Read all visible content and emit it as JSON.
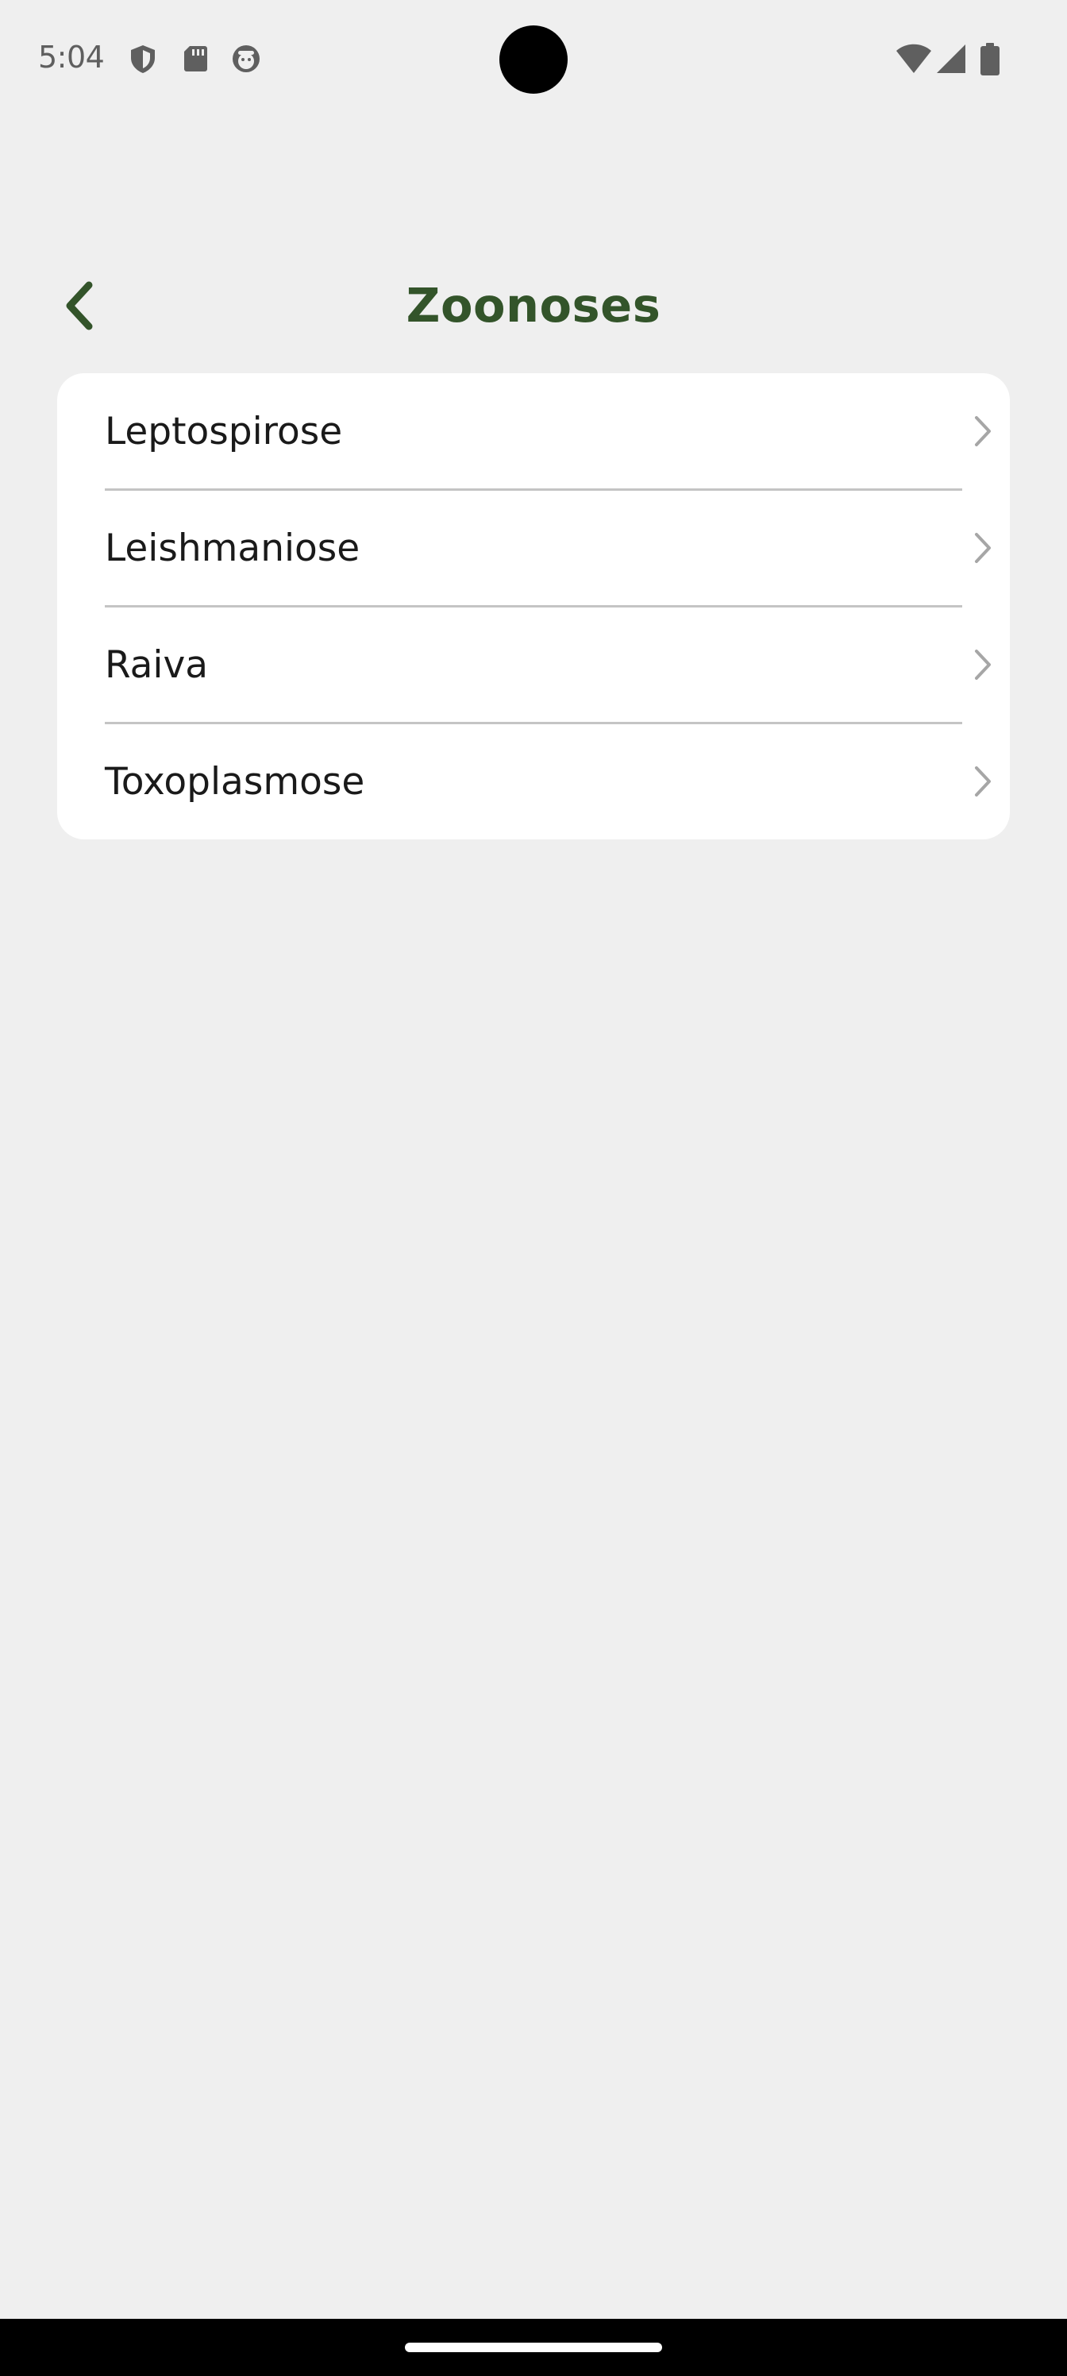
{
  "status_bar": {
    "time": "5:04",
    "left_icons": [
      "shield-icon",
      "sd-card-icon",
      "face-icon"
    ],
    "right_icons": [
      "wifi-icon",
      "cellular-signal-icon",
      "battery-icon"
    ]
  },
  "header": {
    "title": "Zoonoses",
    "back_icon": "chevron-left-icon"
  },
  "list": {
    "items": [
      {
        "label": "Leptospirose"
      },
      {
        "label": "Leishmaniose"
      },
      {
        "label": "Raiva"
      },
      {
        "label": "Toxoplasmose"
      }
    ]
  },
  "colors": {
    "accent": "#33542a",
    "background": "#efefef",
    "card": "#ffffff",
    "text": "#1a1a1a",
    "chevron": "#a6a6a6"
  }
}
